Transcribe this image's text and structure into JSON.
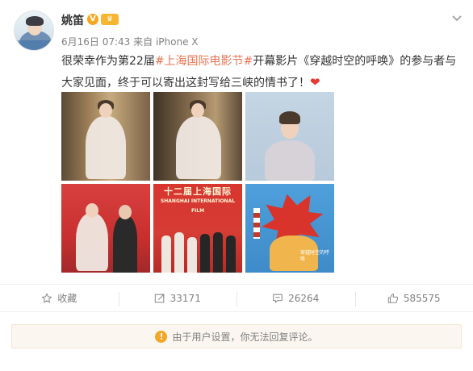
{
  "post": {
    "author": "姚笛",
    "verified_mark": "V",
    "badge_mark": "♛",
    "timestamp": "6月16日 07:43",
    "source": "来自 iPhone X",
    "text_part1": "很荣幸作为第22届",
    "hashtag": "#上海国际电影节#",
    "text_part2": "开幕影片《穿越时空的呼唤》的参与者与大家见面，终于可以寄出这封写给三峡的情书了！",
    "emoji": "❤"
  },
  "images": {
    "banner_line1": "十二届上海国际",
    "banner_line2": "SHANGHAI INTERNATIONAL FILM",
    "poster_text": "穿越时空的呼唤"
  },
  "actions": {
    "favorite_label": "收藏",
    "repost_count": "33171",
    "comment_count": "26264",
    "like_count": "585575"
  },
  "notice": {
    "icon": "!",
    "text": "由于用户设置，你无法回复评论。"
  },
  "colors": {
    "accent": "#eb7350",
    "text_gray": "#808080",
    "badge_orange": "#f5a623"
  }
}
